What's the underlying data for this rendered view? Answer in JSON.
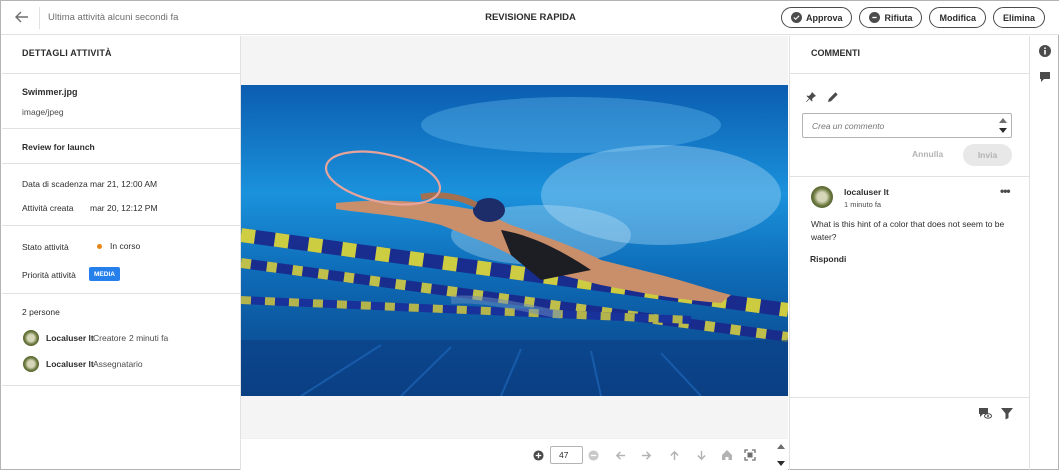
{
  "header": {
    "last_activity": "Ultima attività alcuni secondi fa",
    "title": "REVISIONE RAPIDA",
    "buttons": {
      "approve": "Approva",
      "reject": "Rifiuta",
      "edit": "Modifica",
      "delete": "Elimina"
    }
  },
  "details": {
    "heading": "DETTAGLI ATTIVITÀ",
    "file_name": "Swimmer.jpg",
    "file_type": "image/jpeg",
    "description": "Review for launch",
    "due_label": "Data di scadenza",
    "due_value": "mar 21, 12:00 AM",
    "created_label": "Attività creata",
    "created_value": "mar 20, 12:12 PM",
    "state_label": "Stato attività",
    "state_value": "In corso",
    "priority_label": "Priorità attività",
    "priority_value": "MEDIA",
    "people_count": "2 persone",
    "people": [
      {
        "name": "Localuser lt",
        "role": "Creatore",
        "time": "2 minuti fa"
      },
      {
        "name": "Localuser lt",
        "role": "Assegnatario",
        "time": ""
      }
    ]
  },
  "viewer": {
    "zoom": "47"
  },
  "comments": {
    "heading": "COMMENTI",
    "input_placeholder": "Crea un commento",
    "cancel": "Annulla",
    "send": "Invia",
    "items": [
      {
        "author": "localuser lt",
        "time": "1 minuto fa",
        "text": "What is this hint of a color that does not seem to be water?",
        "reply": "Rispondi"
      }
    ]
  },
  "colors": {
    "accent": "#2680eb",
    "status_in_progress": "#e68619",
    "annotation": "#e8a49a"
  }
}
